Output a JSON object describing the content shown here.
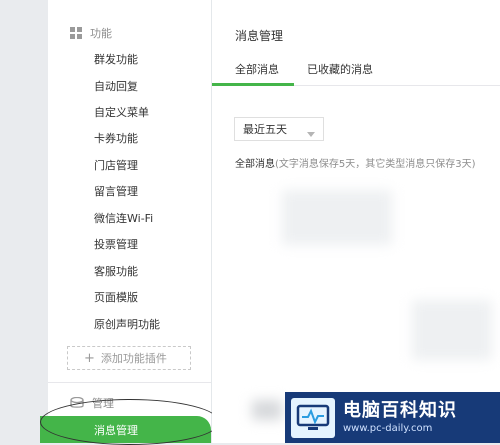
{
  "sidebar": {
    "function_header": "功能",
    "items": [
      {
        "label": "群发功能"
      },
      {
        "label": "自动回复"
      },
      {
        "label": "自定义菜单"
      },
      {
        "label": "卡券功能"
      },
      {
        "label": "门店管理"
      },
      {
        "label": "留言管理"
      },
      {
        "label": "微信连Wi-Fi"
      },
      {
        "label": "投票管理"
      },
      {
        "label": "客服功能"
      },
      {
        "label": "页面模版"
      },
      {
        "label": "原创声明功能"
      }
    ],
    "add_plugin_label": "添加功能插件",
    "manage_header": "管理",
    "active_item": "消息管理",
    "accent_color": "#44b549"
  },
  "main": {
    "title": "消息管理",
    "tabs": [
      {
        "label": "全部消息",
        "active": true
      },
      {
        "label": "已收藏的消息",
        "active": false
      }
    ],
    "filter_select": {
      "value": "最近五天"
    },
    "note_main": "全部消息",
    "note_detail": "(文字消息保存5天，其它类型消息只保存3天)"
  },
  "watermark": {
    "title": "电脑百科知识",
    "url": "www.pc-daily.com"
  }
}
